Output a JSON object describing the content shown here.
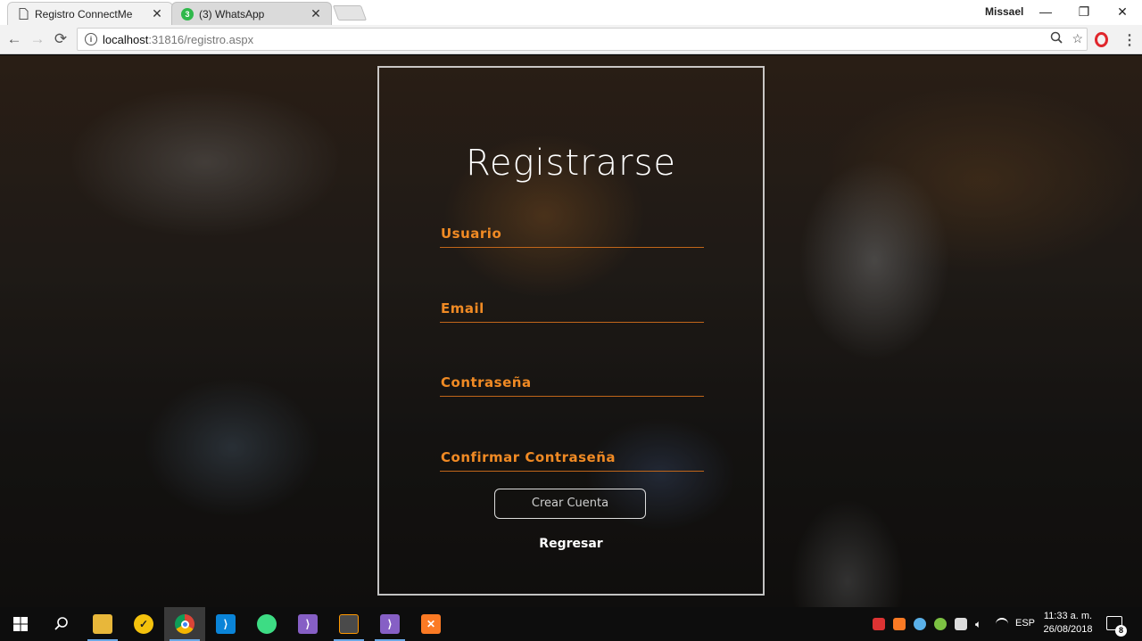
{
  "browser": {
    "tabs": [
      {
        "title": "Registro ConnectMe",
        "active": true
      },
      {
        "title": "(3) WhatsApp",
        "badge": "3",
        "active": false
      }
    ],
    "close_glyph": "✕",
    "profile_name": "Missael",
    "window_controls": {
      "minimize": "—",
      "maximize": "❐",
      "close": "✕"
    },
    "url_host": "localhost",
    "url_rest": ":31816/registro.aspx"
  },
  "form": {
    "title": "Registrarse",
    "fields": [
      {
        "label": "Usuario"
      },
      {
        "label": "Email"
      },
      {
        "label": "Contraseña"
      },
      {
        "label": "Confirmar Contraseña"
      }
    ],
    "submit_label": "Crear Cuenta",
    "back_link": "Regresar"
  },
  "taskbar": {
    "apps": [
      "start",
      "search",
      "file-explorer",
      "norton",
      "chrome",
      "vscode",
      "android-studio",
      "visual-studio",
      "sublime",
      "visual-studio-2",
      "xampp"
    ],
    "language": "ESP",
    "time": "11:33 a. m.",
    "date": "26/08/2018",
    "notification_count": "8"
  },
  "colors": {
    "accent_orange": "#f08a24",
    "underline": "#c1661a",
    "panel_border": "#ffffff"
  }
}
